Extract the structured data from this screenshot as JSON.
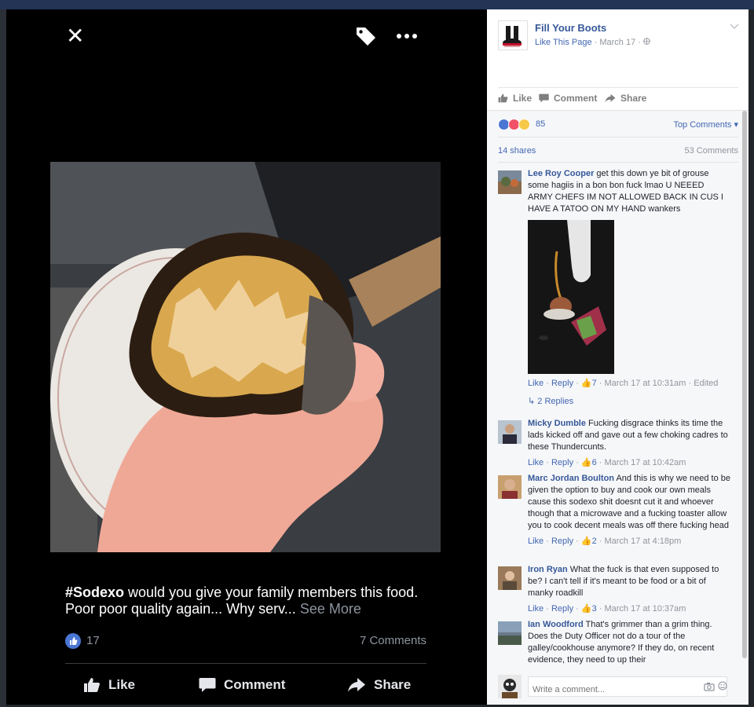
{
  "viewer": {
    "caption_hashtag": "#Sodexo",
    "caption_rest": " would you give your family members this food. Poor poor quality again...  Why serv... ",
    "see_more": "See More",
    "like_count": "17",
    "comments_count": "7 Comments",
    "like_label": "Like",
    "comment_label": "Comment",
    "share_label": "Share",
    "close_glyph": "✕"
  },
  "post": {
    "page_name": "Fill Your Boots",
    "like_page": "Like This Page",
    "date": " · March 17 · ",
    "like_label": "Like",
    "comment_label": "Comment",
    "share_label": "Share",
    "reactions_count": "85",
    "top_comments": "Top Comments ▾",
    "shares": "14 shares",
    "comments_total": "53 Comments"
  },
  "comments": [
    {
      "author": "Lee Roy Cooper",
      "text": " get this down ye bit of grouse some hagiis in a bon bon fuck lmao U NEEED ARMY CHEFS IM NOT ALLOWED BACK IN CUS I HAVE A TATOO ON MY HAND wankers",
      "like": "Like",
      "reply": "Reply",
      "likes": "7",
      "time": " · March 17 at 10:31am · Edited",
      "replies": "2 Replies"
    },
    {
      "author": "Micky Dumble",
      "text": " Fucking disgrace thinks its time the lads kicked off and gave out a few choking cadres to these Thundercunts.",
      "like": "Like",
      "reply": "Reply",
      "likes": "6",
      "time": " · March 17 at 10:42am"
    },
    {
      "author": "Marc Jordan Boulton",
      "text": " And this is why we need to be given the option to buy and cook our own meals cause this sodexo shit doesnt cut it and whoever though that a microwave and a fucking toaster allow you to cook decent meals was off there fucking head",
      "like": "Like",
      "reply": "Reply",
      "likes": "2",
      "time": " · March 17 at 4:18pm"
    },
    {
      "author": "Iron Ryan",
      "text": " What the fuck is that even supposed to be? I can't tell if it's meant to be food or a bit of manky roadkill",
      "like": "Like",
      "reply": "Reply",
      "likes": "3",
      "time": " · March 17 at 10:37am"
    },
    {
      "author": "Ian Woodford",
      "text": " That's grimmer than a grim thing. Does the Duty Officer not do a tour of the galley/cookhouse anymore? If they do, on recent evidence, they need to up their"
    }
  ],
  "composer": {
    "placeholder": "Write a comment..."
  },
  "colors": {
    "link": "#365899",
    "like_blue": "#4267b2",
    "viewer_bg": "#000000",
    "panel_gray": "#f6f7f9"
  }
}
